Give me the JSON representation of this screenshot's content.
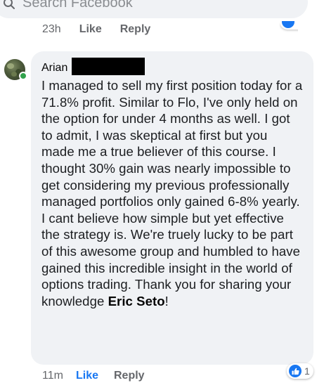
{
  "search": {
    "placeholder": "Search Facebook",
    "icon": "search-icon"
  },
  "previous_comment": {
    "timestamp": "23h",
    "like_label": "Like",
    "reply_label": "Reply"
  },
  "comment": {
    "author": "Arian",
    "author_redacted": true,
    "avatar_online": true,
    "text": "I managed to sell my first position today for a 71.8% profit. Similar to Flo, I've only held on the option for under 4 months as well. I got to admit, I was skeptical at first but you made me a true believer of this course. I thought 30% gain was nearly impossible to get considering my previous professionally managed portfolios only gained 6-8% yearly. I cant believe how simple but yet effective the strategy is. We're truely lucky to be part of this awesome group and humbled to have gained this incredible insight in the world of options trading. Thank you for sharing your knowledge ",
    "mention": "Eric Seto",
    "text_end": "!",
    "timestamp": "11m",
    "like_label": "Like",
    "reply_label": "Reply",
    "reaction_count": "1",
    "reaction_icon": "like-icon"
  },
  "colors": {
    "accent": "#1877f2",
    "bubble_bg": "#f0f2f5",
    "online": "#31a24c",
    "secondary_text": "#65676b"
  }
}
